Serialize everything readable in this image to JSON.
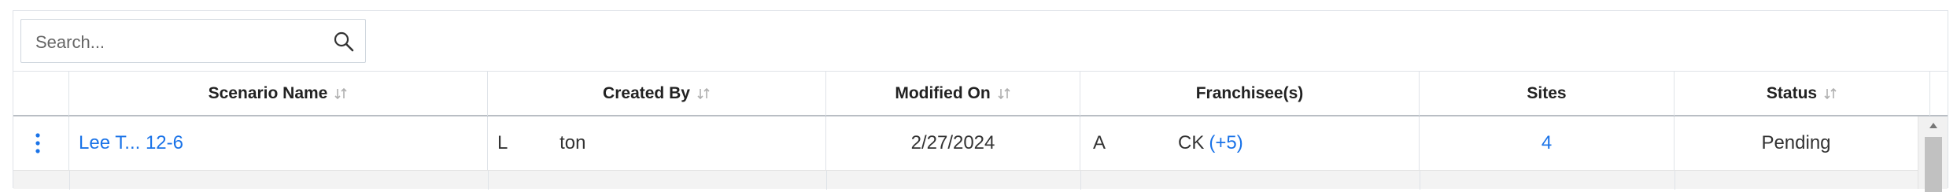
{
  "search": {
    "placeholder": "Search..."
  },
  "table": {
    "columns": [
      {
        "label": "",
        "sortable": false
      },
      {
        "label": "Scenario Name",
        "sortable": true
      },
      {
        "label": "Created By",
        "sortable": true
      },
      {
        "label": "Modified On",
        "sortable": true
      },
      {
        "label": "Franchisee(s)",
        "sortable": false
      },
      {
        "label": "Sites",
        "sortable": false
      },
      {
        "label": "Status",
        "sortable": true
      }
    ],
    "rows": [
      {
        "scenario_name": "Lee T... 12-6",
        "created_by": "L          ton",
        "modified_on": "2/27/2024",
        "franchisee": "A              CK",
        "franchisee_more": "(+5)",
        "sites": "4",
        "status": "Pending"
      }
    ]
  },
  "colors": {
    "link": "#1a73e8",
    "border": "#dfe3e8",
    "header_rule": "#b9bec4",
    "row_alt": "#f3f3f3"
  },
  "icons": {
    "search": "search-icon",
    "sort": "sort-icon",
    "row_menu": "kebab-menu-icon",
    "scroll_up": "scroll-up-arrow-icon"
  }
}
